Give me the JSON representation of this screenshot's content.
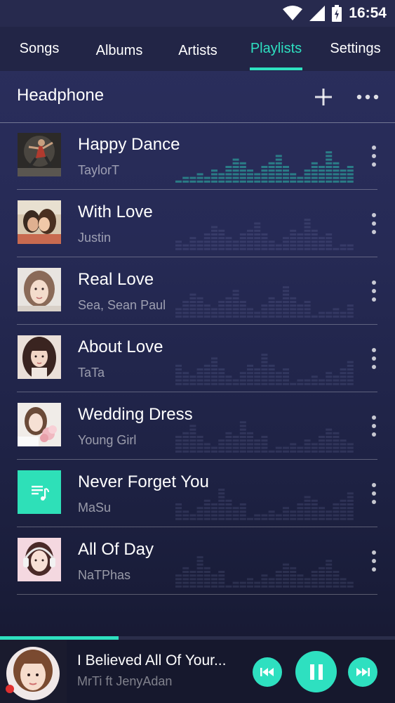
{
  "status_bar": {
    "time": "16:54",
    "wifi_icon": "wifi-icon",
    "signal_icon": "signal-icon",
    "battery_icon": "battery-charging-icon"
  },
  "tabs": [
    {
      "label": "Songs",
      "active": false
    },
    {
      "label": "Albums",
      "active": false
    },
    {
      "label": "Artists",
      "active": false
    },
    {
      "label": "Playlists",
      "active": true
    },
    {
      "label": "Settings",
      "active": false
    }
  ],
  "header": {
    "title": "Headphone",
    "add_icon": "plus-icon",
    "more_icon": "more-horizontal-icon"
  },
  "playlist": [
    {
      "title": "Happy Dance",
      "artist": "TaylorT",
      "playing": true,
      "thumb": "dancer"
    },
    {
      "title": "With Love",
      "artist": "Justin",
      "playing": false,
      "thumb": "couple"
    },
    {
      "title": "Real Love",
      "artist": "Sea, Sean Paul",
      "playing": false,
      "thumb": "portrait"
    },
    {
      "title": "About Love",
      "artist": "TaTa",
      "playing": false,
      "thumb": "portrait"
    },
    {
      "title": "Wedding Dress",
      "artist": "Young Girl",
      "playing": false,
      "thumb": "bride"
    },
    {
      "title": "Never Forget You",
      "artist": "MaSu",
      "playing": false,
      "thumb": "music-note-icon"
    },
    {
      "title": "All Of Day",
      "artist": "NaTPhas",
      "playing": false,
      "thumb": "headphones-girl"
    }
  ],
  "now_playing": {
    "title": "I Believed All Of Your...",
    "artist": "MrTi ft JenyAdan",
    "progress": 0.3,
    "controls": [
      "previous-icon",
      "pause-icon",
      "next-icon"
    ]
  },
  "colors": {
    "accent": "#2ee0c0",
    "background": "#262a55",
    "tab_bar": "#222546"
  }
}
